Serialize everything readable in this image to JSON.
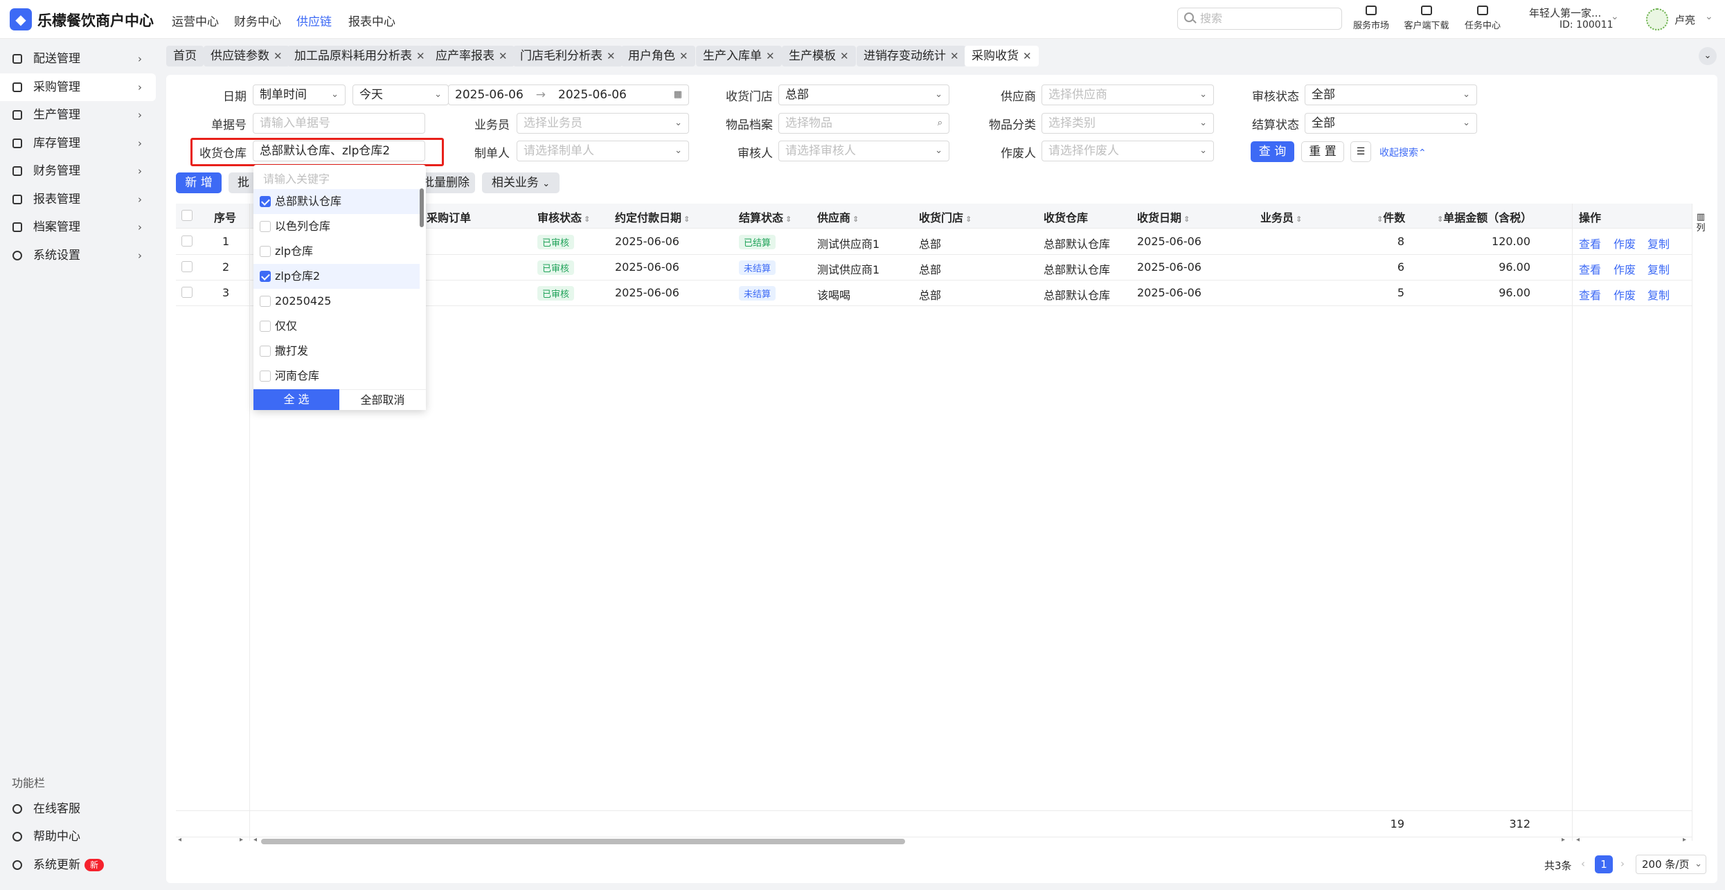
{
  "app": {
    "title": "乐檬餐饮商户中心"
  },
  "topnav": [
    "运营中心",
    "财务中心",
    "供应链",
    "报表中心"
  ],
  "active_nav": "供应链",
  "search": {
    "placeholder": "搜索"
  },
  "tools": [
    "服务市场",
    "客户端下载",
    "任务中心"
  ],
  "user": {
    "shop": "年轻人第一家...",
    "id": "ID: 100011",
    "name": "卢亮"
  },
  "sidebar": {
    "items": [
      "配送管理",
      "采购管理",
      "生产管理",
      "库存管理",
      "财务管理",
      "报表管理",
      "档案管理",
      "系统设置"
    ],
    "selected": "采购管理",
    "function_title": "功能栏",
    "functions": [
      "在线客服",
      "帮助中心",
      "系统更新"
    ],
    "new_badge": "新"
  },
  "tabs": [
    "首页",
    "供应链参数",
    "加工品原料耗用分析表",
    "应产率报表",
    "门店毛利分析表",
    "用户角色",
    "生产入库单",
    "生产模板",
    "进销存变动统计",
    "采购收货"
  ],
  "active_tab": "采购收货",
  "filters": {
    "date_label": "日期",
    "date_type": "制单时间",
    "date_range": "今天",
    "date_start": "2025-06-06",
    "date_end": "2025-06-06",
    "store_label": "收货门店",
    "store_value": "总部",
    "supplier_label": "供应商",
    "supplier_ph": "选择供应商",
    "audit_label": "审核状态",
    "audit_value": "全部",
    "docno_label": "单据号",
    "docno_ph": "请输入单据号",
    "salesman_label": "业务员",
    "salesman_ph": "选择业务员",
    "item_label": "物品档案",
    "item_ph": "选择物品",
    "category_label": "物品分类",
    "category_ph": "选择类别",
    "settle_label": "结算状态",
    "settle_value": "全部",
    "warehouse_label": "收货仓库",
    "warehouse_value": "总部默认仓库、zlp仓库2",
    "creator_label": "制单人",
    "creator_ph": "请选择制单人",
    "auditor_label": "审核人",
    "auditor_ph": "请选择审核人",
    "voider_label": "作废人",
    "voider_ph": "请选择作废人",
    "query": "查 询",
    "reset": "重 置",
    "collapse": "收起搜索"
  },
  "actions": {
    "add": "新 增",
    "batch": "批量",
    "batch_delete": "批量删除",
    "related": "相关业务"
  },
  "dropdown": {
    "search_ph": "请输入关键字",
    "options": [
      {
        "label": "总部默认仓库",
        "checked": true
      },
      {
        "label": "以色列仓库",
        "checked": false
      },
      {
        "label": "zlp仓库",
        "checked": false
      },
      {
        "label": "zlp仓库2",
        "checked": true
      },
      {
        "label": "20250425",
        "checked": false
      },
      {
        "label": "仅仅",
        "checked": false
      },
      {
        "label": "撒打发",
        "checked": false
      },
      {
        "label": "河南仓库",
        "checked": false
      }
    ],
    "select_all": "全 选",
    "deselect_all": "全部取消"
  },
  "table": {
    "headers": {
      "seq": "序号",
      "order": "采购订单",
      "audit": "审核状态",
      "pay_date": "约定付款日期",
      "settle": "结算状态",
      "supplier": "供应商",
      "store": "收货门店",
      "warehouse": "收货仓库",
      "recv_date": "收货日期",
      "salesman": "业务员",
      "qty": "件数",
      "amount": "单据金额（含税）",
      "ops": "操作"
    },
    "rows": [
      {
        "seq": "1",
        "audit": "已审核",
        "pay_date": "2025-06-06",
        "settle": "已结算",
        "supplier": "测试供应商1",
        "store": "总部",
        "warehouse": "总部默认仓库",
        "recv_date": "2025-06-06",
        "qty": "8",
        "amount": "120.00"
      },
      {
        "seq": "2",
        "audit": "已审核",
        "pay_date": "2025-06-06",
        "settle": "未结算",
        "supplier": "测试供应商1",
        "store": "总部",
        "warehouse": "总部默认仓库",
        "recv_date": "2025-06-06",
        "qty": "6",
        "amount": "96.00"
      },
      {
        "seq": "3",
        "audit": "已审核",
        "pay_date": "2025-06-06",
        "settle": "未结算",
        "supplier": "该喝喝",
        "store": "总部",
        "warehouse": "总部默认仓库",
        "recv_date": "2025-06-06",
        "qty": "5",
        "amount": "96.00"
      }
    ],
    "row_ops": [
      "查看",
      "作废",
      "复制"
    ],
    "column_setting": "列",
    "total_qty": "19",
    "total_amount": "312"
  },
  "pagination": {
    "total": "共3条",
    "current": "1",
    "page_size": "200 条/页"
  },
  "colors": {
    "primary": "#3d6af5",
    "highlight_border": "#e8201a",
    "settled_tag": "#21a35a"
  }
}
